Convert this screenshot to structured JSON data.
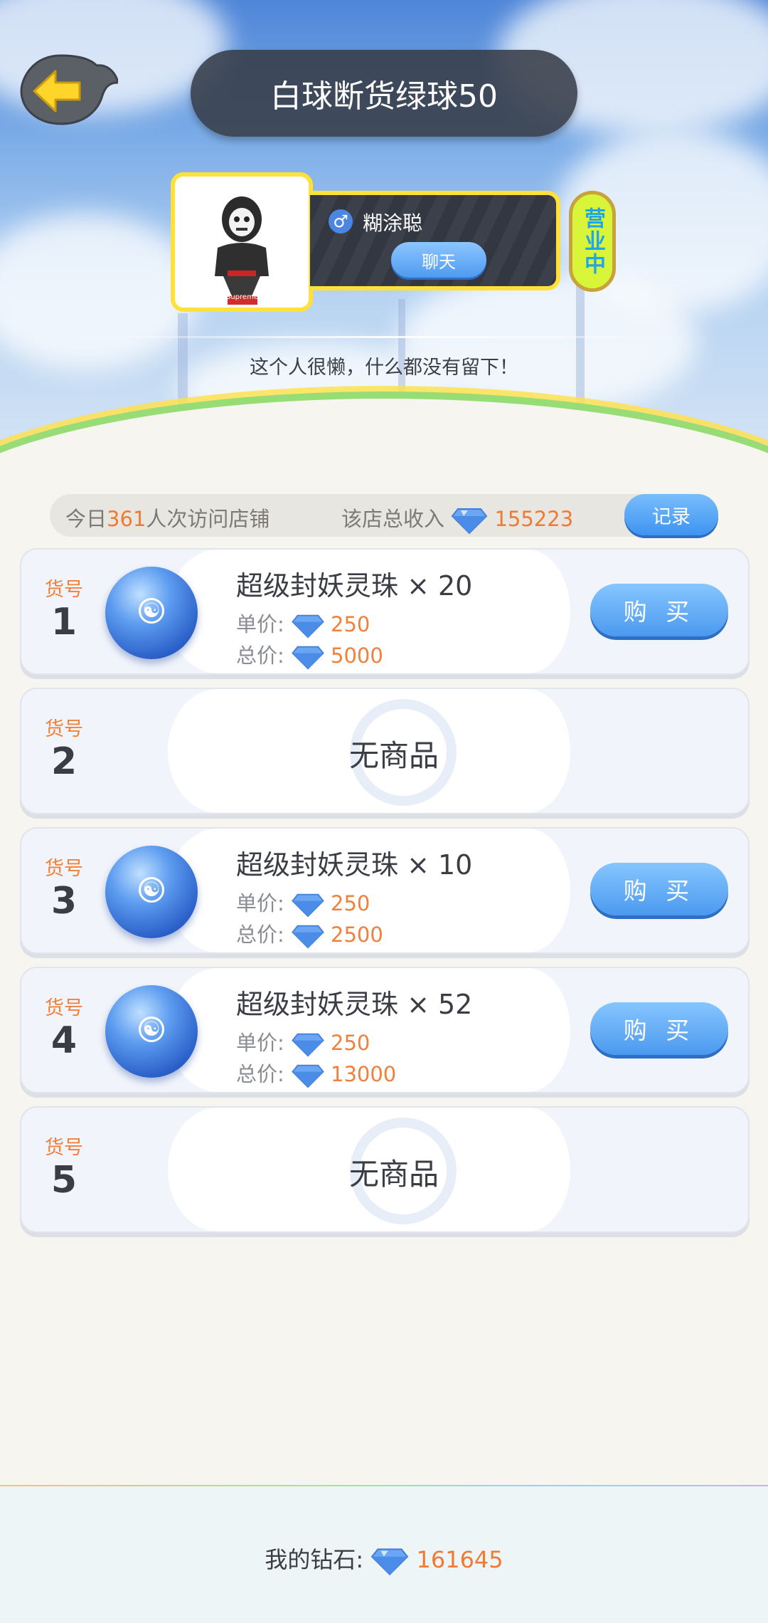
{
  "header": {
    "title": "白球断货绿球50",
    "owner_name": "糊涂聪",
    "owner_gender": "♂",
    "chat_label": "聊天",
    "status_label": "营业中",
    "bio": "这个人很懒，什么都没有留下！",
    "avatar_brand": "Supreme"
  },
  "stats": {
    "today_prefix": "今日",
    "today_visits": "361",
    "today_suffix": "人次访问店铺",
    "income_label": "该店总收入",
    "income_value": "155223",
    "record_label": "记录"
  },
  "items": [
    {
      "slot_label": "货号",
      "slot_num": "1",
      "name": "超级封妖灵珠 × 20",
      "unit_label": "单价:",
      "unit_price": "250",
      "total_label": "总价:",
      "total_price": "5000",
      "buy_label": "购 买"
    },
    {
      "slot_label": "货号",
      "slot_num": "2",
      "empty_label": "无商品"
    },
    {
      "slot_label": "货号",
      "slot_num": "3",
      "name": "超级封妖灵珠 × 10",
      "unit_label": "单价:",
      "unit_price": "250",
      "total_label": "总价:",
      "total_price": "2500",
      "buy_label": "购 买"
    },
    {
      "slot_label": "货号",
      "slot_num": "4",
      "name": "超级封妖灵珠 × 52",
      "unit_label": "单价:",
      "unit_price": "250",
      "total_label": "总价:",
      "total_price": "13000",
      "buy_label": "购 买"
    },
    {
      "slot_label": "货号",
      "slot_num": "5",
      "empty_label": "无商品"
    }
  ],
  "footer": {
    "my_diamonds_label": "我的钻石:",
    "my_diamonds_value": "161645"
  },
  "colors": {
    "accent_orange": "#f07a33",
    "button_blue": "#4b99ef",
    "frame_yellow": "#ffe13a"
  }
}
